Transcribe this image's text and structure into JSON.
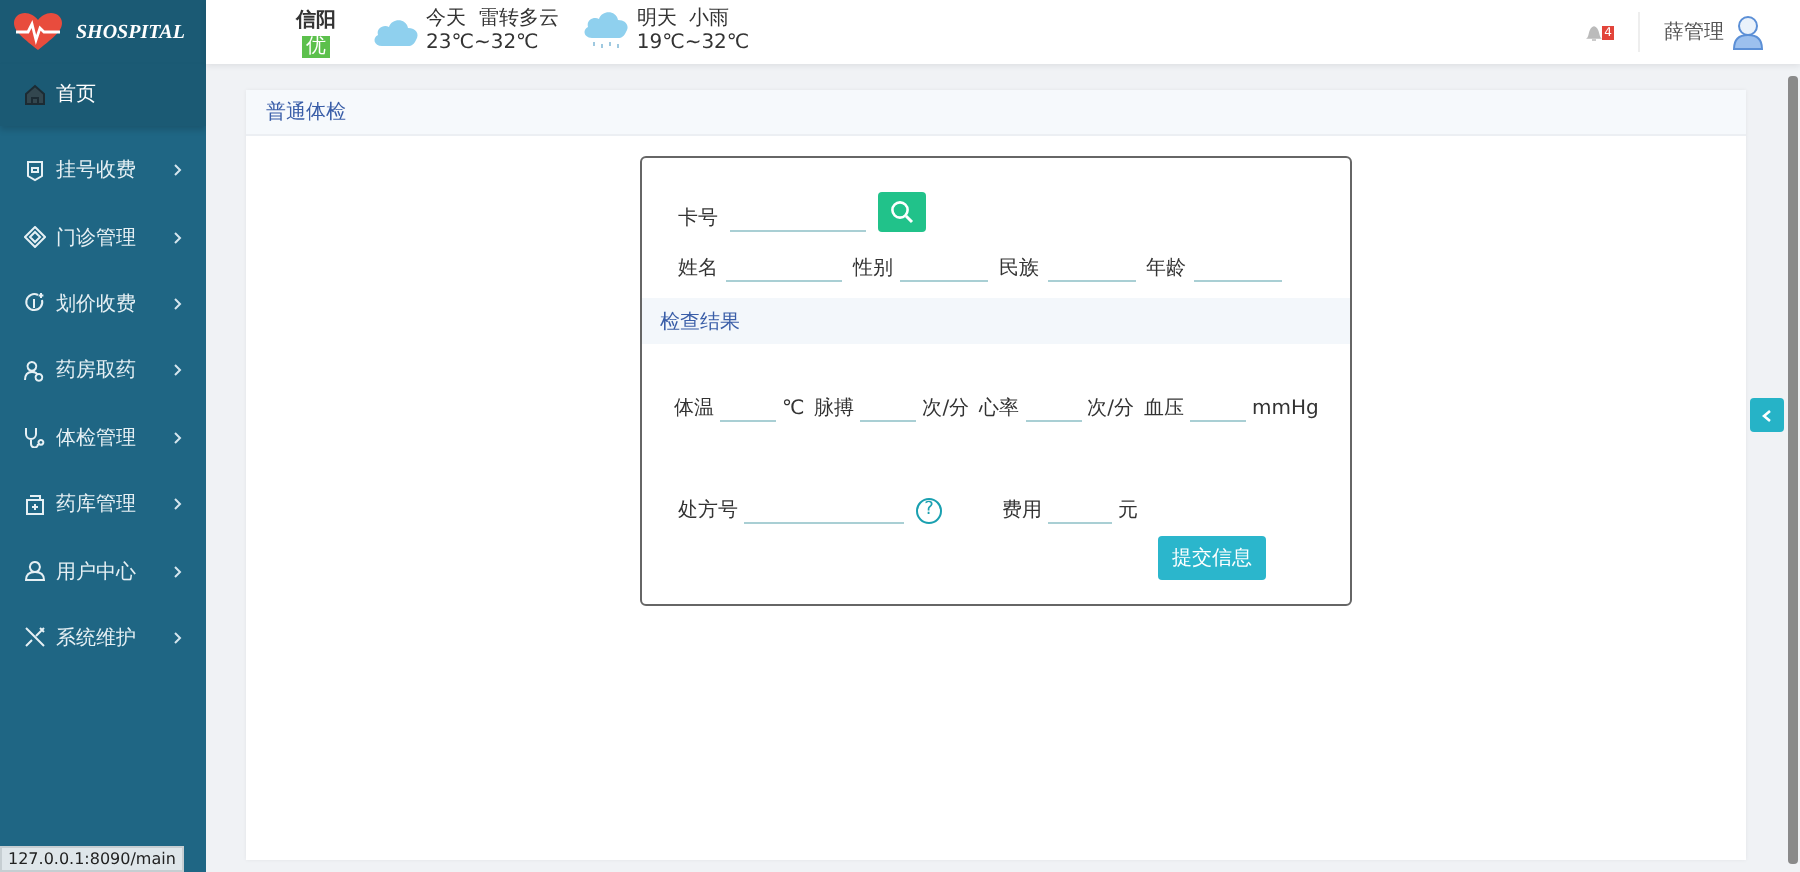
{
  "header": {
    "logo": "SHOSPITAL",
    "city": "信阳",
    "air_quality": "优",
    "weather": [
      {
        "day": "今天",
        "condition": "雷转多云",
        "temp": "23℃~32℃",
        "kind": "cloudy"
      },
      {
        "day": "明天",
        "condition": "小雨",
        "temp": "19℃~32℃",
        "kind": "rain"
      }
    ],
    "notifications": "4",
    "user": "薛管理"
  },
  "sidebar": {
    "items": [
      {
        "label": "首页",
        "selected": true,
        "has_children": false
      },
      {
        "label": "挂号收费",
        "selected": false,
        "has_children": true
      },
      {
        "label": "门诊管理",
        "selected": false,
        "has_children": true
      },
      {
        "label": "划价收费",
        "selected": false,
        "has_children": true
      },
      {
        "label": "药房取药",
        "selected": false,
        "has_children": true
      },
      {
        "label": "体检管理",
        "selected": false,
        "has_children": true
      },
      {
        "label": "药库管理",
        "selected": false,
        "has_children": true
      },
      {
        "label": "用户中心",
        "selected": false,
        "has_children": true
      },
      {
        "label": "系统维护",
        "selected": false,
        "has_children": true
      }
    ]
  },
  "card": {
    "title": "普通体检",
    "card_no": {
      "label": "卡号"
    },
    "patient_fields": [
      {
        "label": "姓名"
      },
      {
        "label": "性别"
      },
      {
        "label": "民族"
      },
      {
        "label": "年龄"
      }
    ],
    "section_title": "检查结果",
    "vitals": [
      {
        "label": "体温",
        "unit": "℃"
      },
      {
        "label": "脉搏",
        "unit": "次/分"
      },
      {
        "label": "心率",
        "unit": "次/分"
      },
      {
        "label": "血压",
        "unit": "mmHg"
      }
    ],
    "prescription": {
      "label": "处方号",
      "help": "?"
    },
    "fee": {
      "label": "费用",
      "unit": "元"
    },
    "submit": "提交信息"
  },
  "status_bar": {
    "url": "127.0.0.1:8090/main"
  }
}
